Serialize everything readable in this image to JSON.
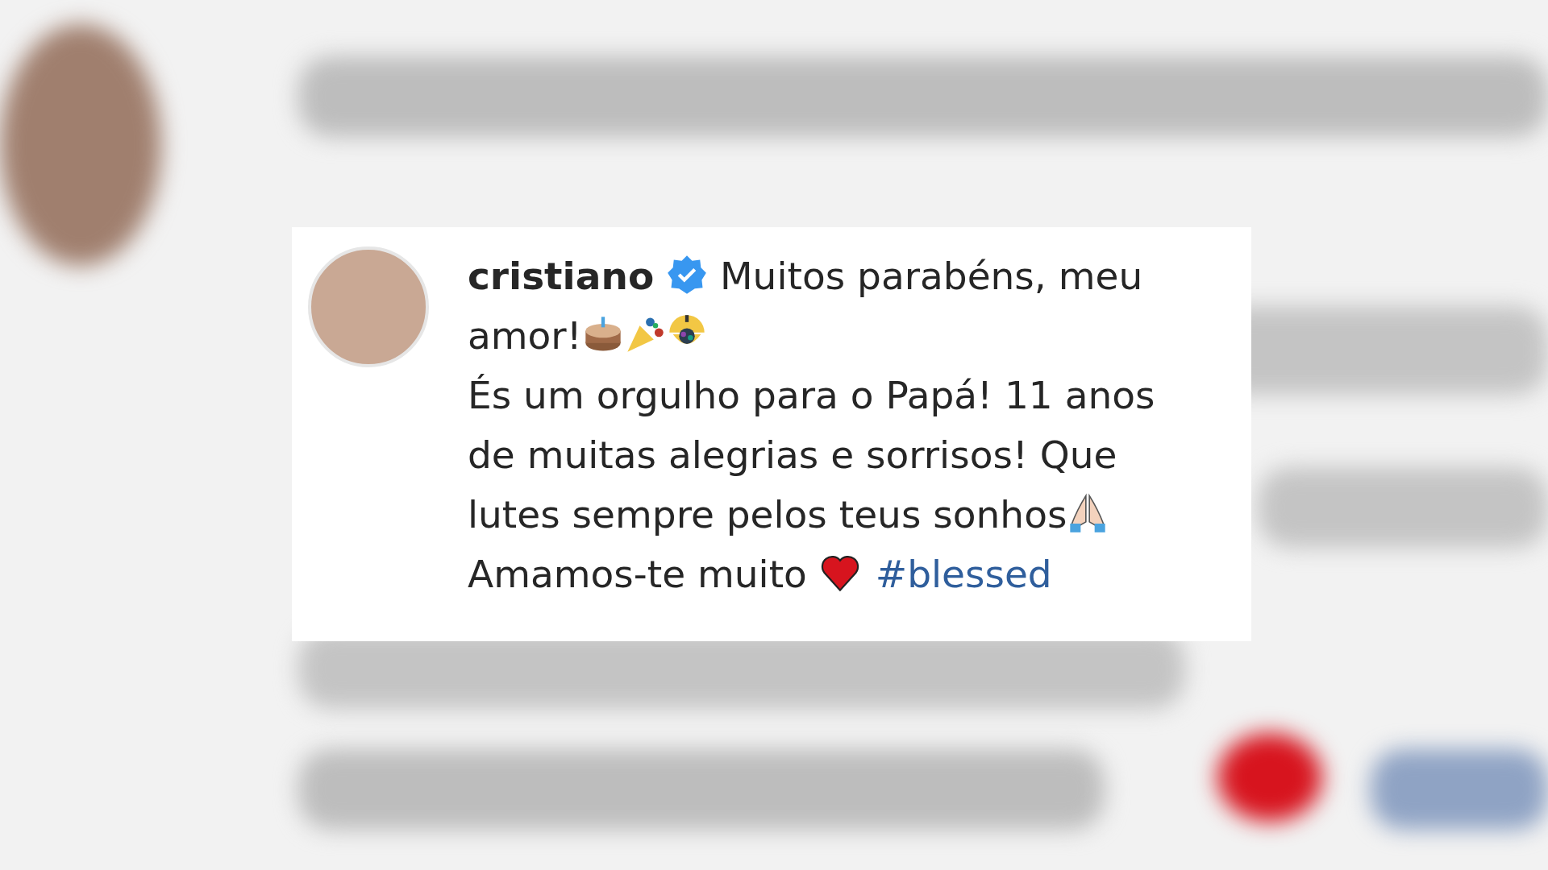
{
  "comment_card": {
    "username": "cristiano",
    "verified": true,
    "caption": [
      {
        "kind": "text",
        "text": " Muitos parabéns, meu"
      },
      {
        "kind": "break"
      },
      {
        "kind": "text",
        "text": "amor!"
      },
      {
        "kind": "cake"
      },
      {
        "kind": "popper"
      },
      {
        "kind": "confetti"
      },
      {
        "kind": "break"
      },
      {
        "kind": "text",
        "text": "És um orgulho para o Papá! 11 anos"
      },
      {
        "kind": "break"
      },
      {
        "kind": "text",
        "text": "de muitas alegrias e sorrisos! Que"
      },
      {
        "kind": "break"
      },
      {
        "kind": "text",
        "text": "lutes sempre pelos teus sonhos"
      },
      {
        "kind": "pray"
      },
      {
        "kind": "break"
      },
      {
        "kind": "text",
        "text": "Amamos-te muito "
      },
      {
        "kind": "heart"
      },
      {
        "kind": "hashtag",
        "text": "#blessed"
      }
    ]
  }
}
